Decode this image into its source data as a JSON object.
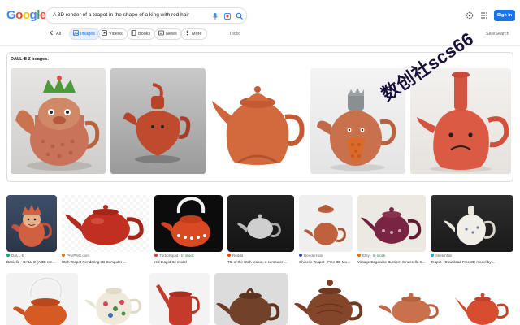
{
  "header": {
    "logo_letters": [
      {
        "ch": "G",
        "color": "#4285f4"
      },
      {
        "ch": "o",
        "color": "#ea4335"
      },
      {
        "ch": "o",
        "color": "#fbbc05"
      },
      {
        "ch": "g",
        "color": "#4285f4"
      },
      {
        "ch": "l",
        "color": "#34a853"
      },
      {
        "ch": "e",
        "color": "#ea4335"
      }
    ],
    "query": "A 3D render of a teapot in the shape of a king with red hair",
    "signin_label": "Sign in",
    "icons": [
      "mic-icon",
      "lens-icon",
      "search-icon",
      "settings-icon",
      "apps-grid-icon"
    ]
  },
  "tabs": [
    {
      "label": "All",
      "icon": "back-arrow-icon"
    },
    {
      "label": "Images",
      "icon": "images-icon",
      "active": true
    },
    {
      "label": "Videos",
      "icon": "videos-icon"
    },
    {
      "label": "Books",
      "icon": "books-icon"
    },
    {
      "label": "News",
      "icon": "news-icon"
    },
    {
      "label": "More",
      "icon": "more-icon"
    }
  ],
  "tools_label": "Tools",
  "safesearch_label": "SafeSearch",
  "dalle": {
    "title": "DALL·E 2 images:",
    "tiles": [
      {
        "desc": "teapot-green-crown"
      },
      {
        "desc": "teapot-gray-bg"
      },
      {
        "desc": "teapot-round-orange"
      },
      {
        "desc": "teapot-gray-crown-beard"
      },
      {
        "desc": "teapot-sad-face"
      }
    ]
  },
  "results_row1": [
    {
      "source": "DALL·E",
      "stock": "",
      "title": "Danielle • DALL·E (A 3D rend..."
    },
    {
      "source": "PAVPNG.com",
      "stock": "",
      "title": "Utah Teapot Rendering 3D Computer ..."
    },
    {
      "source": "TurboSquid",
      "stock": "· In stock",
      "title": "red teapot 3d model"
    },
    {
      "source": "Reddit",
      "stock": "",
      "title": "TIL of the Utah teapot, a computer ..."
    },
    {
      "source": "RenderHub",
      "stock": "",
      "title": "Chinese Teapot - Free 3D Mo..."
    },
    {
      "source": "Etsy",
      "stock": "· In stock",
      "title": "Vintage Edgewise Burslem Cinderella S..."
    },
    {
      "source": "Sketchfab",
      "stock": "",
      "title": "Teapot - Download Free 3D model by ..."
    }
  ],
  "results_row2": [
    {
      "desc": "teapot-white-handle"
    },
    {
      "desc": "teapot-floral"
    },
    {
      "desc": "teapot-tall-spout"
    },
    {
      "desc": "teapot-clay-dark"
    },
    {
      "desc": "teapot-clay-ornate"
    },
    {
      "desc": "teapot-clay-small"
    },
    {
      "desc": "teapot-red-spout"
    }
  ],
  "watermark": "数创社scs66"
}
